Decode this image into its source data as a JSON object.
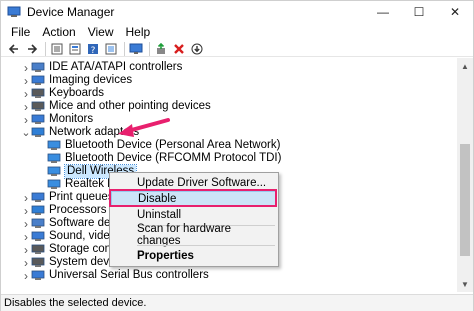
{
  "window": {
    "title": "Device Manager",
    "minimize_glyph": "—",
    "maximize_glyph": "☐",
    "close_glyph": "✕"
  },
  "menubar": {
    "items": [
      "File",
      "Action",
      "View",
      "Help"
    ]
  },
  "toolbar": {
    "buttons": [
      "back-icon",
      "forward-icon",
      "properties-icon",
      "sheet-icon",
      "help-icon",
      "sheet-icon",
      "monitor-icon",
      "add-driver-icon",
      "uninstall-icon",
      "download-icon"
    ]
  },
  "tree": {
    "rows": [
      {
        "label": "IDE ATA/ATAPI controllers",
        "expanded": false,
        "indent": 0
      },
      {
        "label": "Imaging devices",
        "expanded": false,
        "indent": 0
      },
      {
        "label": "Keyboards",
        "expanded": false,
        "indent": 0
      },
      {
        "label": "Mice and other pointing devices",
        "expanded": false,
        "indent": 0
      },
      {
        "label": "Monitors",
        "expanded": false,
        "indent": 0
      },
      {
        "label": "Network adapters",
        "expanded": true,
        "indent": 0
      },
      {
        "label": "Bluetooth Device (Personal Area Network)",
        "indent": 1
      },
      {
        "label": "Bluetooth Device (RFCOMM Protocol TDI)",
        "indent": 1
      },
      {
        "label": "Dell Wireless",
        "indent": 1,
        "selected": true
      },
      {
        "label": "Realtek PCIe",
        "indent": 1
      },
      {
        "label": "Print queues",
        "expanded": false,
        "indent": 0
      },
      {
        "label": "Processors",
        "expanded": false,
        "indent": 0
      },
      {
        "label": "Software devices",
        "expanded": false,
        "indent": 0
      },
      {
        "label": "Sound, video",
        "expanded": false,
        "indent": 0
      },
      {
        "label": "Storage controlle",
        "expanded": false,
        "indent": 0
      },
      {
        "label": "System devices",
        "expanded": false,
        "indent": 0
      },
      {
        "label": "Universal Serial Bus controllers",
        "expanded": false,
        "indent": 0
      }
    ]
  },
  "context_menu": {
    "update": "Update Driver Software...",
    "disable": "Disable",
    "uninstall": "Uninstall",
    "scan": "Scan for hardware changes",
    "properties": "Properties"
  },
  "statusbar": {
    "text": "Disables the selected device."
  },
  "colors": {
    "accent_highlight": "#e8206e",
    "selection": "#cce8ff",
    "menu_hover": "#cce4f7"
  }
}
